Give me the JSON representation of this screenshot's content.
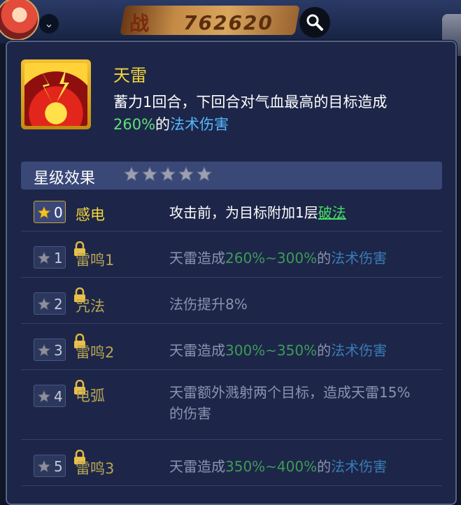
{
  "topbar": {
    "power_label": "战",
    "power_value": "762620"
  },
  "skill": {
    "name": "天雷",
    "desc_main": "蓄力1回合，下回合对气血最高的目标造成",
    "desc_pct": "260%",
    "desc_of": "的",
    "desc_damage": "法术伤害"
  },
  "star_effect": {
    "label": "星级效果",
    "star_count": 5
  },
  "levels": [
    {
      "num": "0",
      "name": "感电",
      "effect_pre": "攻击前，为目标附加1层",
      "effect_link": "破法"
    },
    {
      "num": "1",
      "name": "雷鸣1",
      "effect_pre": "天雷造成",
      "effect_pct": "260%~300%",
      "effect_of": "的",
      "effect_damage": "法术伤害"
    },
    {
      "num": "2",
      "name": "咒法",
      "effect_pre": "法伤提升8%"
    },
    {
      "num": "3",
      "name": "雷鸣2",
      "effect_pre": "天雷造成",
      "effect_pct": "300%~350%",
      "effect_of": "的",
      "effect_damage": "法术伤害"
    },
    {
      "num": "4",
      "name": "电弧",
      "effect_pre": "天雷额外溅射两个目标，造成天雷15%的伤害"
    },
    {
      "num": "5",
      "name": "雷鸣3",
      "effect_pre": "天雷造成",
      "effect_pct": "350%~400%",
      "effect_of": "的",
      "effect_damage": "法术伤害"
    }
  ]
}
